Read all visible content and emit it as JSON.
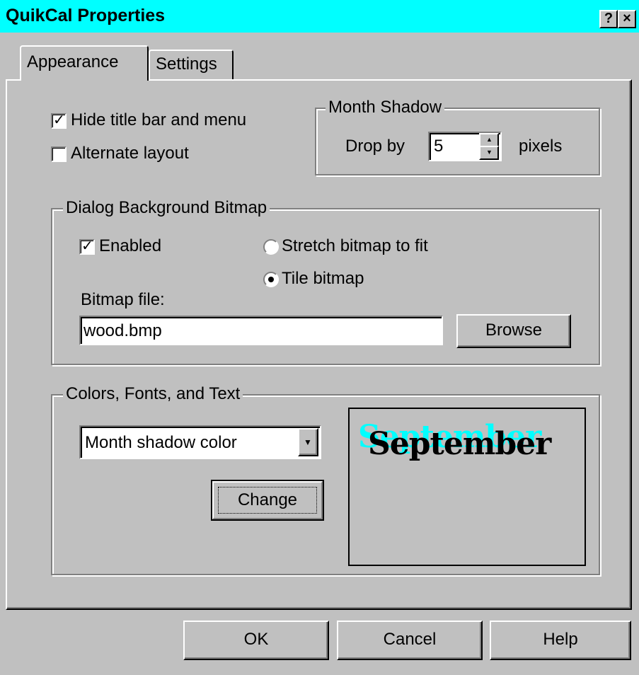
{
  "window": {
    "title": "QuikCal Properties",
    "help_button": "?",
    "close_button": "×"
  },
  "tabs": [
    {
      "label": "Appearance",
      "active": true
    },
    {
      "label": "Settings",
      "active": false
    }
  ],
  "appearance": {
    "hide_title_bar": {
      "label": "Hide title bar and menu",
      "checked": true
    },
    "alternate_layout": {
      "label": "Alternate layout",
      "checked": false
    },
    "month_shadow": {
      "group_label": "Month Shadow",
      "drop_by_label": "Drop by",
      "value": "5",
      "unit_label": "pixels"
    },
    "background_bitmap": {
      "group_label": "Dialog Background Bitmap",
      "enabled": {
        "label": "Enabled",
        "checked": true
      },
      "stretch": {
        "label": "Stretch bitmap to fit",
        "selected": false
      },
      "tile": {
        "label": "Tile bitmap",
        "selected": true
      },
      "file_label": "Bitmap file:",
      "file_value": "wood.bmp",
      "browse_label": "Browse"
    },
    "colors_fonts_text": {
      "group_label": "Colors, Fonts, and Text",
      "selected_option": "Month shadow color",
      "change_label": "Change",
      "preview_text": "September",
      "preview_shadow_color": "#00ffff",
      "preview_text_color": "#000000"
    }
  },
  "footer": {
    "ok_label": "OK",
    "cancel_label": "Cancel",
    "help_label": "Help"
  },
  "colors": {
    "title_bar": "#00ffff",
    "face": "#c0c0c0"
  }
}
